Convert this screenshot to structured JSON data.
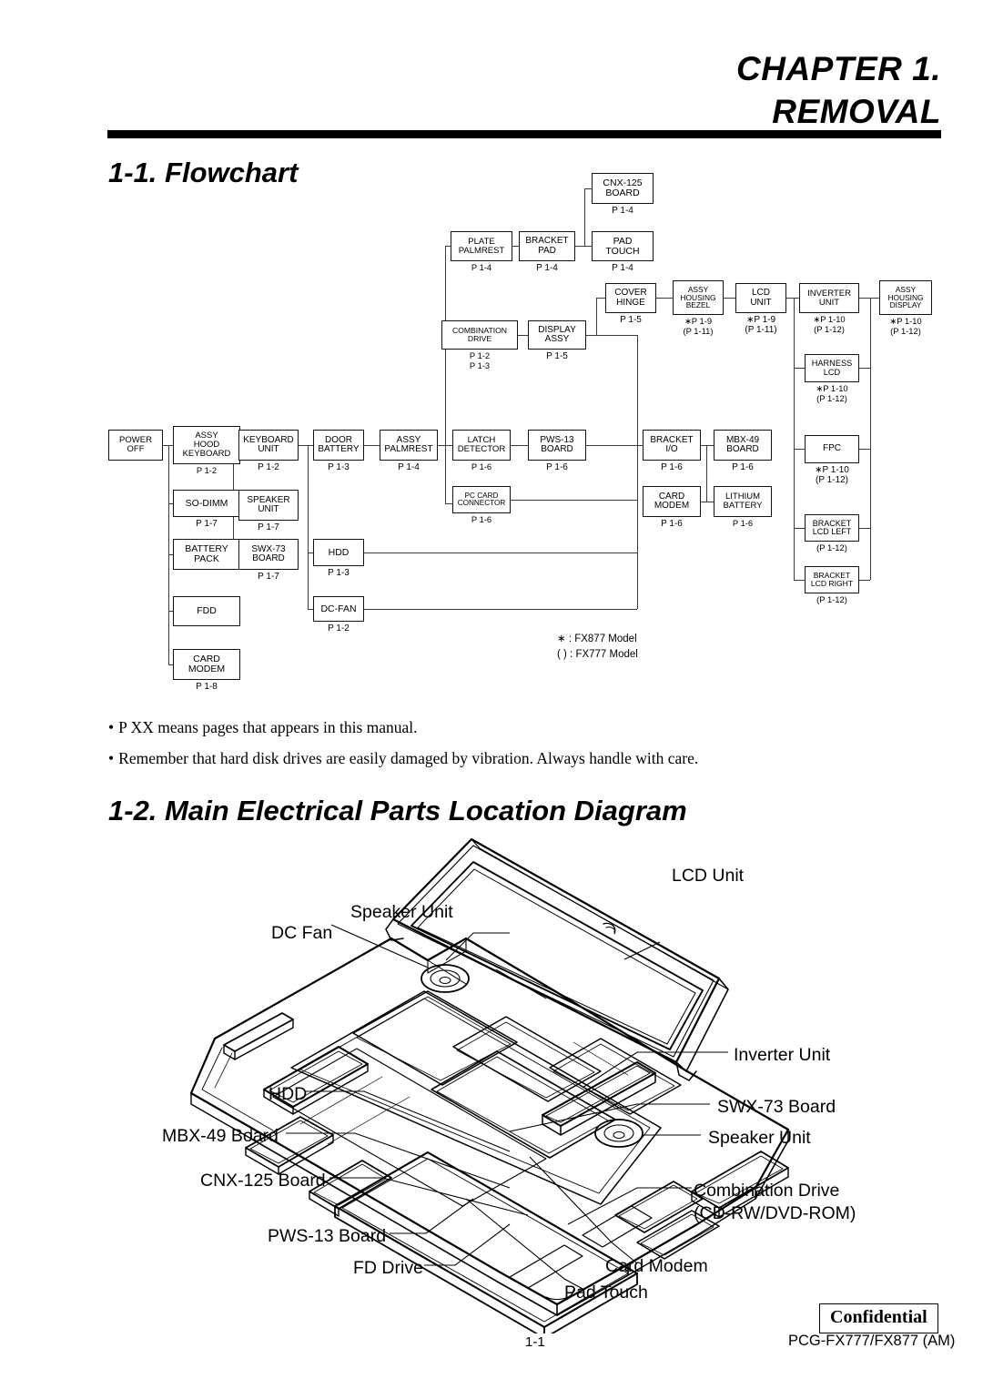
{
  "header": {
    "chapter_line1": "CHAPTER 1.",
    "chapter_line2": "REMOVAL"
  },
  "sections": {
    "flowchart_title": "1-1. Flowchart",
    "parts_title": "1-2. Main Electrical Parts Location Diagram"
  },
  "flowchart": {
    "boxes": [
      {
        "id": "power-off",
        "lines": [
          "POWER",
          "OFF"
        ],
        "page": ""
      },
      {
        "id": "assy-hood-keyboard",
        "lines": [
          "ASSY",
          "HOOD",
          "KEYBOARD"
        ],
        "page": "P 1-2"
      },
      {
        "id": "so-dimm",
        "lines": [
          "SO-DIMM"
        ],
        "page": "P 1-7"
      },
      {
        "id": "battery-pack",
        "lines": [
          "BATTERY",
          "PACK"
        ],
        "page": ""
      },
      {
        "id": "fdd",
        "lines": [
          "FDD"
        ],
        "page": ""
      },
      {
        "id": "card-modem-left",
        "lines": [
          "CARD",
          "MODEM"
        ],
        "page": "P 1-8"
      },
      {
        "id": "keyboard-unit",
        "lines": [
          "KEYBOARD",
          "UNIT"
        ],
        "page": "P 1-2"
      },
      {
        "id": "speaker-unit",
        "lines": [
          "SPEAKER",
          "UNIT"
        ],
        "page": "P 1-7"
      },
      {
        "id": "swx-73-board",
        "lines": [
          "SWX-73",
          "BOARD"
        ],
        "page": "P 1-7"
      },
      {
        "id": "door-battery",
        "lines": [
          "DOOR",
          "BATTERY"
        ],
        "page": "P 1-3"
      },
      {
        "id": "hdd",
        "lines": [
          "HDD"
        ],
        "page": "P 1-3"
      },
      {
        "id": "dc-fan",
        "lines": [
          "DC-FAN"
        ],
        "page": "P 1-2"
      },
      {
        "id": "assy-palmrest",
        "lines": [
          "ASSY",
          "PALMREST"
        ],
        "page": "P 1-4"
      },
      {
        "id": "plate-palmrest",
        "lines": [
          "PLATE",
          "PALMREST"
        ],
        "page": "P 1-4"
      },
      {
        "id": "bracket-pad",
        "lines": [
          "BRACKET",
          "PAD"
        ],
        "page": "P 1-4"
      },
      {
        "id": "cnx-125-board",
        "lines": [
          "CNX-125",
          "BOARD"
        ],
        "page": "P 1-4"
      },
      {
        "id": "pad-touch",
        "lines": [
          "PAD",
          "TOUCH"
        ],
        "page": "P 1-4"
      },
      {
        "id": "combination-drive",
        "lines": [
          "COMBINATION",
          "DRIVE"
        ],
        "page": "P 1-2\nP 1-3"
      },
      {
        "id": "display-assy",
        "lines": [
          "DISPLAY",
          "ASSY"
        ],
        "page": "P 1-5"
      },
      {
        "id": "cover-hinge",
        "lines": [
          "COVER",
          "HINGE"
        ],
        "page": "P 1-5"
      },
      {
        "id": "assy-housing-bezel",
        "lines": [
          "ASSY",
          "HOUSING",
          "BEZEL"
        ],
        "page": "∗P 1-9\n(P 1-11)"
      },
      {
        "id": "lcd-unit",
        "lines": [
          "LCD",
          "UNIT"
        ],
        "page": "∗P 1-9\n(P 1-11)"
      },
      {
        "id": "inverter-unit",
        "lines": [
          "INVERTER",
          "UNIT"
        ],
        "page": "∗P 1-10\n(P 1-12)"
      },
      {
        "id": "assy-housing-display",
        "lines": [
          "ASSY",
          "HOUSING",
          "DISPLAY"
        ],
        "page": "∗P 1-10\n(P 1-12)"
      },
      {
        "id": "harness-lcd",
        "lines": [
          "HARNESS",
          "LCD"
        ],
        "page": "∗P 1-10\n(P 1-12)"
      },
      {
        "id": "fpc",
        "lines": [
          "FPC"
        ],
        "page": "∗P 1-10\n(P 1-12)"
      },
      {
        "id": "bracket-lcd-left",
        "lines": [
          "BRACKET",
          "LCD LEFT"
        ],
        "page": "(P 1-12)"
      },
      {
        "id": "bracket-lcd-right",
        "lines": [
          "BRACKET",
          "LCD RIGHT"
        ],
        "page": "(P 1-12)"
      },
      {
        "id": "latch-detector",
        "lines": [
          "LATCH",
          "DETECTOR"
        ],
        "page": "P 1-6"
      },
      {
        "id": "pc-card-connector",
        "lines": [
          "PC CARD",
          "CONNECTOR"
        ],
        "page": "P 1-6"
      },
      {
        "id": "pws-13-board",
        "lines": [
          "PWS-13",
          "BOARD"
        ],
        "page": "P 1-6"
      },
      {
        "id": "bracket-io",
        "lines": [
          "BRACKET",
          "I/O"
        ],
        "page": "P 1-6"
      },
      {
        "id": "card-modem-right",
        "lines": [
          "CARD",
          "MODEM"
        ],
        "page": "P 1-6"
      },
      {
        "id": "mbx-49-board",
        "lines": [
          "MBX-49",
          "BOARD"
        ],
        "page": "P 1-6"
      },
      {
        "id": "lithium-battery",
        "lines": [
          "LITHIUM",
          "BATTERY"
        ],
        "page": "P 1-6"
      }
    ],
    "legend": [
      "∗ : FX877  Model",
      "(  ) : FX777  Model"
    ]
  },
  "notes": [
    {
      "bullet": "•",
      "text": "P XX means pages that appears in this manual."
    },
    {
      "bullet": "•",
      "text": "Remember that hard disk drives are easily damaged by vibration.  Always handle with care."
    }
  ],
  "illustration": {
    "callouts": [
      {
        "id": "lcd-unit",
        "text": "LCD Unit"
      },
      {
        "id": "speaker-unit-top",
        "text": "Speaker Unit"
      },
      {
        "id": "dc-fan",
        "text": "DC Fan"
      },
      {
        "id": "inverter-unit",
        "text": "Inverter Unit"
      },
      {
        "id": "hdd",
        "text": "HDD"
      },
      {
        "id": "swx-73-board",
        "text": "SWX-73 Board"
      },
      {
        "id": "mbx-49-board",
        "text": "MBX-49 Board"
      },
      {
        "id": "speaker-unit-right",
        "text": "Speaker Unit"
      },
      {
        "id": "cnx-125-board",
        "text": "CNX-125 Board"
      },
      {
        "id": "combination-drive",
        "text": "Combination Drive"
      },
      {
        "id": "combination-drive2",
        "text": "(CD-RW/DVD-ROM)"
      },
      {
        "id": "pws-13-board",
        "text": "PWS-13 Board"
      },
      {
        "id": "card-modem",
        "text": "Card Modem"
      },
      {
        "id": "fd-drive",
        "text": "FD Drive"
      },
      {
        "id": "pad-touch",
        "text": "Pad Touch"
      }
    ]
  },
  "footer": {
    "confidential": "Confidential",
    "page_number": "1-1",
    "model": "PCG-FX777/FX877 (AM)"
  }
}
